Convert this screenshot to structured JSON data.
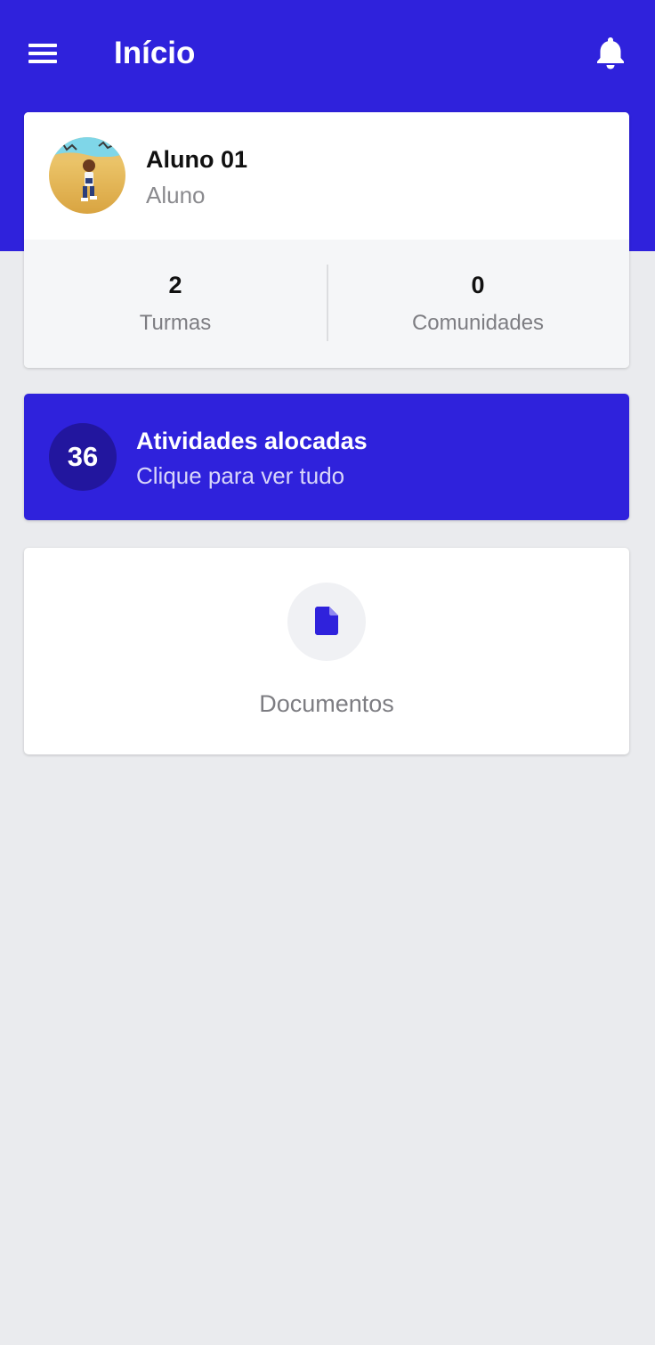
{
  "header": {
    "title": "Início",
    "menu_icon": "hamburger-menu-icon",
    "notification_icon": "bell-icon"
  },
  "profile": {
    "name": "Aluno 01",
    "role": "Aluno",
    "stats": [
      {
        "value": "2",
        "label": "Turmas"
      },
      {
        "value": "0",
        "label": "Comunidades"
      }
    ]
  },
  "activities": {
    "count": "36",
    "title": "Atividades alocadas",
    "subtitle": "Clique para ver tudo"
  },
  "documents": {
    "label": "Documentos",
    "icon": "document-icon"
  },
  "colors": {
    "primary": "#2F22DC",
    "primary_dark": "#22169E",
    "background": "#EAEBEE",
    "card": "#FFFFFF",
    "stats_background": "#F5F6F8",
    "muted_text": "#7D7D82"
  }
}
